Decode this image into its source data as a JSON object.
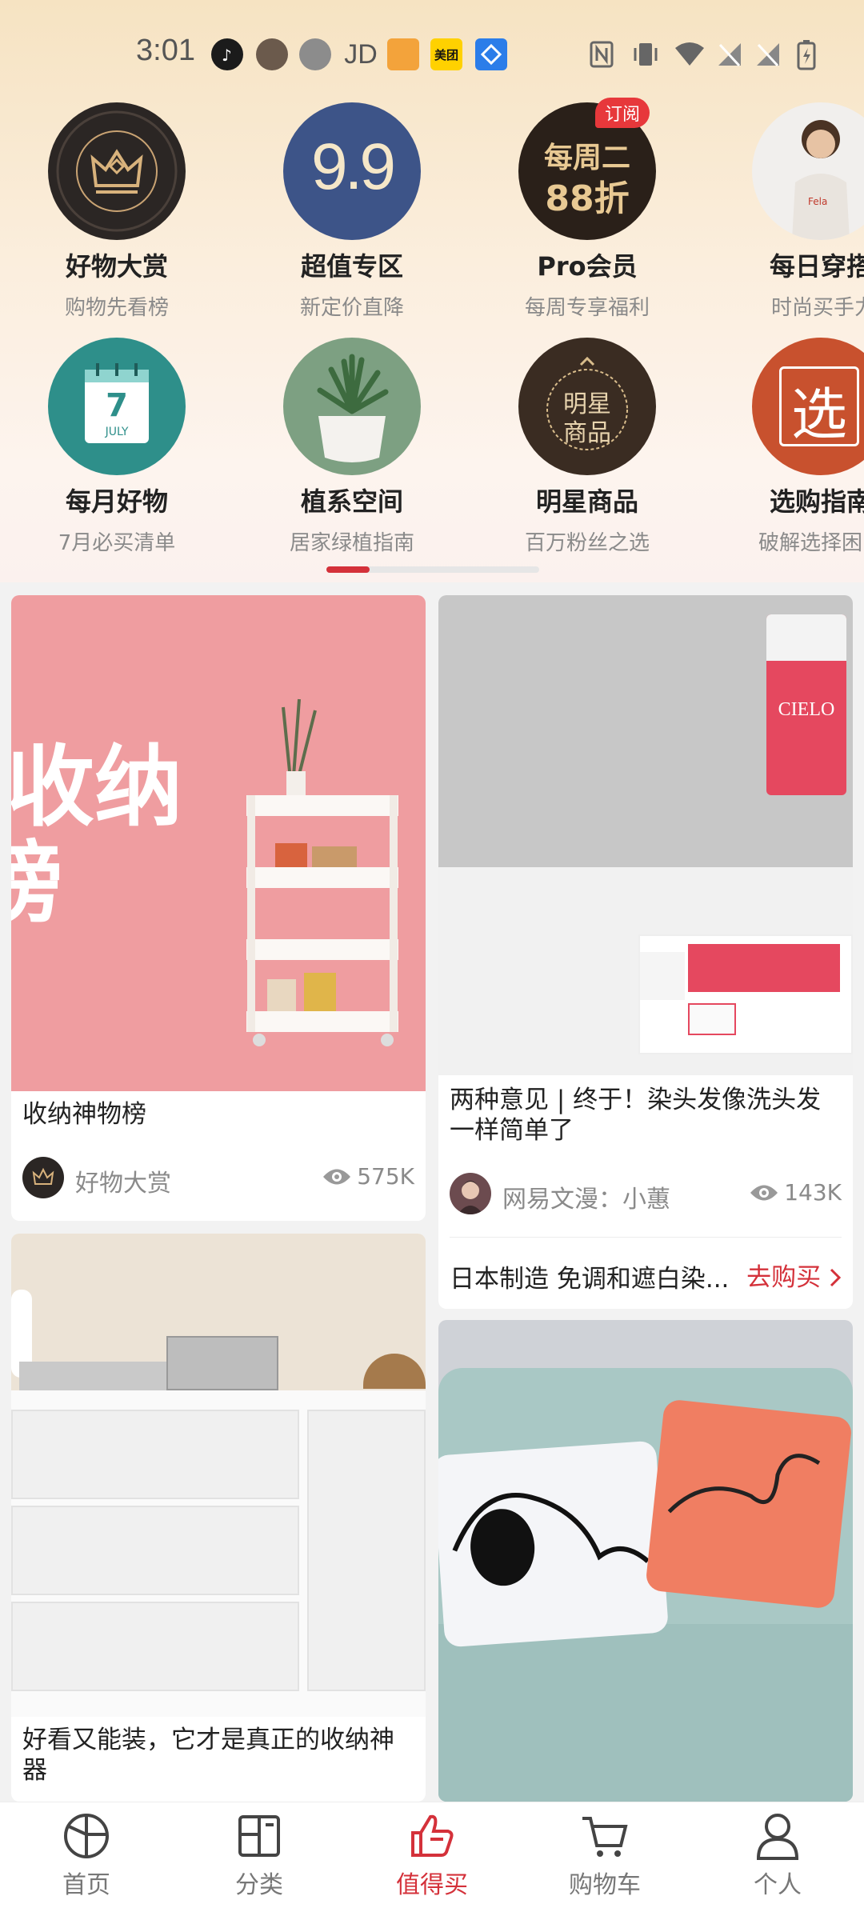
{
  "status_bar": {
    "time": "3:01",
    "apps": [
      "tiktok-icon",
      "app-icon",
      "app-icon",
      "JD",
      "game-icon",
      "美团",
      "app-icon"
    ],
    "meituan": "美团",
    "jd": "JD"
  },
  "categories": [
    {
      "title": "好物大赏",
      "subtitle": "购物先看榜",
      "icon": "crown-icon",
      "color": "#2b2624"
    },
    {
      "title": "超值专区",
      "subtitle": "新定价直降",
      "icon": "price-9.9-icon",
      "color": "#3d5488",
      "glyph": "9.9"
    },
    {
      "title": "Pro会员",
      "subtitle": "每周专享福利",
      "icon": "discount-badge-icon",
      "color": "#2a2019",
      "glyph_line1": "每周二",
      "glyph_line2": "88折",
      "badge": "订阅"
    },
    {
      "title": "每日穿搭",
      "subtitle": "时尚买手力",
      "icon": "model-photo",
      "color": "#f1efed"
    },
    {
      "title": "每月好物",
      "subtitle": "7月必买清单",
      "icon": "calendar-icon",
      "color": "#2e8f8a",
      "glyph": "7",
      "glyph_sub": "JULY"
    },
    {
      "title": "植系空间",
      "subtitle": "居家绿植指南",
      "icon": "plant-icon",
      "color": "#7da082"
    },
    {
      "title": "明星商品",
      "subtitle": "百万粉丝之选",
      "icon": "star-product-icon",
      "color": "#3a2c22",
      "glyph_line1": "明星",
      "glyph_line2": "商品"
    },
    {
      "title": "选购指南",
      "subtitle": "破解选择困",
      "icon": "guide-icon",
      "color": "#c8512e",
      "glyph": "选"
    }
  ],
  "pager": {
    "pages": 2,
    "active": 1
  },
  "feed": [
    {
      "title": "收纳神物榜",
      "image_text_line1": "收纳",
      "image_text_line2": "榜",
      "author": "好物大赏",
      "views": "575K"
    },
    {
      "title": "两种意见 | 终于！染头发像洗头发一样简单了",
      "author": "网易文漫：小蕙",
      "views": "143K",
      "product_brand": "CIELO",
      "buy_text": "日本制造 免调和遮白染...",
      "buy_label": "去购买"
    },
    {
      "title": "好看又能装，它才是真正的收纳神器"
    },
    {
      "title": ""
    }
  ],
  "bottom_nav": [
    {
      "label": "首页",
      "icon": "home-icon"
    },
    {
      "label": "分类",
      "icon": "category-icon"
    },
    {
      "label": "值得买",
      "icon": "thumbs-up-icon",
      "active": true
    },
    {
      "label": "购物车",
      "icon": "cart-icon"
    },
    {
      "label": "个人",
      "icon": "profile-icon"
    }
  ],
  "colors": {
    "accent": "#d4313a",
    "pink_card": "#ef9da0",
    "teal_sofa": "#a9c8c5"
  }
}
